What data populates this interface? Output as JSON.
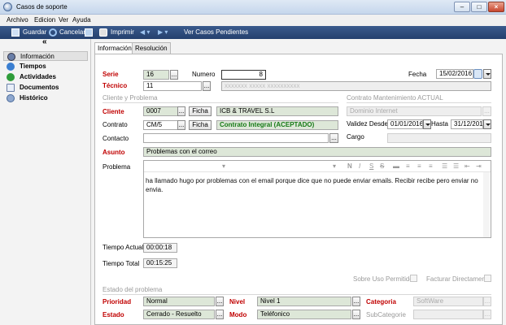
{
  "window": {
    "title": "Casos de soporte"
  },
  "menu": [
    "Archivo",
    "Edicion",
    "Ver",
    "Ayuda"
  ],
  "toolbar": {
    "save": "Guardar",
    "cancel": "Cancelar",
    "print": "Imprimir",
    "pending": "Ver Casos Pendientes"
  },
  "sidebar": {
    "items": [
      "Información",
      "Tiempos",
      "Actividades",
      "Documentos",
      "Histórico"
    ]
  },
  "tabs": [
    "Información",
    "Resolución"
  ],
  "form": {
    "serie_label": "Serie",
    "serie_value": "16",
    "numero_label": "Numero",
    "numero_value": "8",
    "fecha_label": "Fecha",
    "fecha_value": "15/02/2016",
    "tecnico_label": "Técnico",
    "tecnico_value": "11",
    "tecnico_name": "xxxxxxx xxxxx xxxxxxxxxx",
    "section_cliente": "Cliente y Problema",
    "section_contrato": "Contrato Mantenimiento ACTUAL",
    "cliente_label": "Cliente",
    "cliente_code": "0007",
    "cliente_name": "ICB & TRAVEL S.L",
    "ficha_label": "Ficha",
    "contrato_label": "Contrato",
    "contrato_code": "CM/5",
    "contrato_desc": "Contrato Integral (ACEPTADO)",
    "mant_name": "Dominio Internet",
    "validez_label": "Validez Desde",
    "validez_desde": "01/01/2016",
    "hasta_label": "Hasta",
    "hasta_value": "31/12/2016",
    "contacto_label": "Contacto",
    "contacto_value": "",
    "cargo_label": "Cargo",
    "asunto_label": "Asunto",
    "asunto_value": "Problemas con el correo",
    "problema_label": "Problema",
    "problema_text": "ha llamado hugo por problemas con el email porque dice que no puede enviar emails. Recibir recibe pero enviar no envia.",
    "tiempo_actual_label": "Tiempo Actual",
    "tiempo_actual": "00:00:18",
    "tiempo_total_label": "Tiempo Total",
    "tiempo_total": "00:15:25",
    "sobre_uso_label": "Sobre Uso Permitido",
    "facturar_label": "Facturar Directamente",
    "section_estado": "Estado del problema",
    "prioridad_label": "Prioridad",
    "prioridad_value": "Normal",
    "nivel_label": "Nivel",
    "nivel_value": "Nivel 1",
    "categoria_label": "Categoria",
    "categoria_value": "SoftWare",
    "estado_label": "Estado",
    "estado_value": "Cerrado - Resuelto",
    "modo_label": "Modo",
    "modo_value": "Teléfonico",
    "subcategoria_label": "SubCategorie",
    "subcategoria_value": ""
  },
  "editor_toolbar": [
    "N",
    "I",
    "S",
    "S"
  ],
  "colors": {
    "toolbar": "#2b4a7a",
    "required_label": "#c00000",
    "field_green": "#dde7d8"
  }
}
